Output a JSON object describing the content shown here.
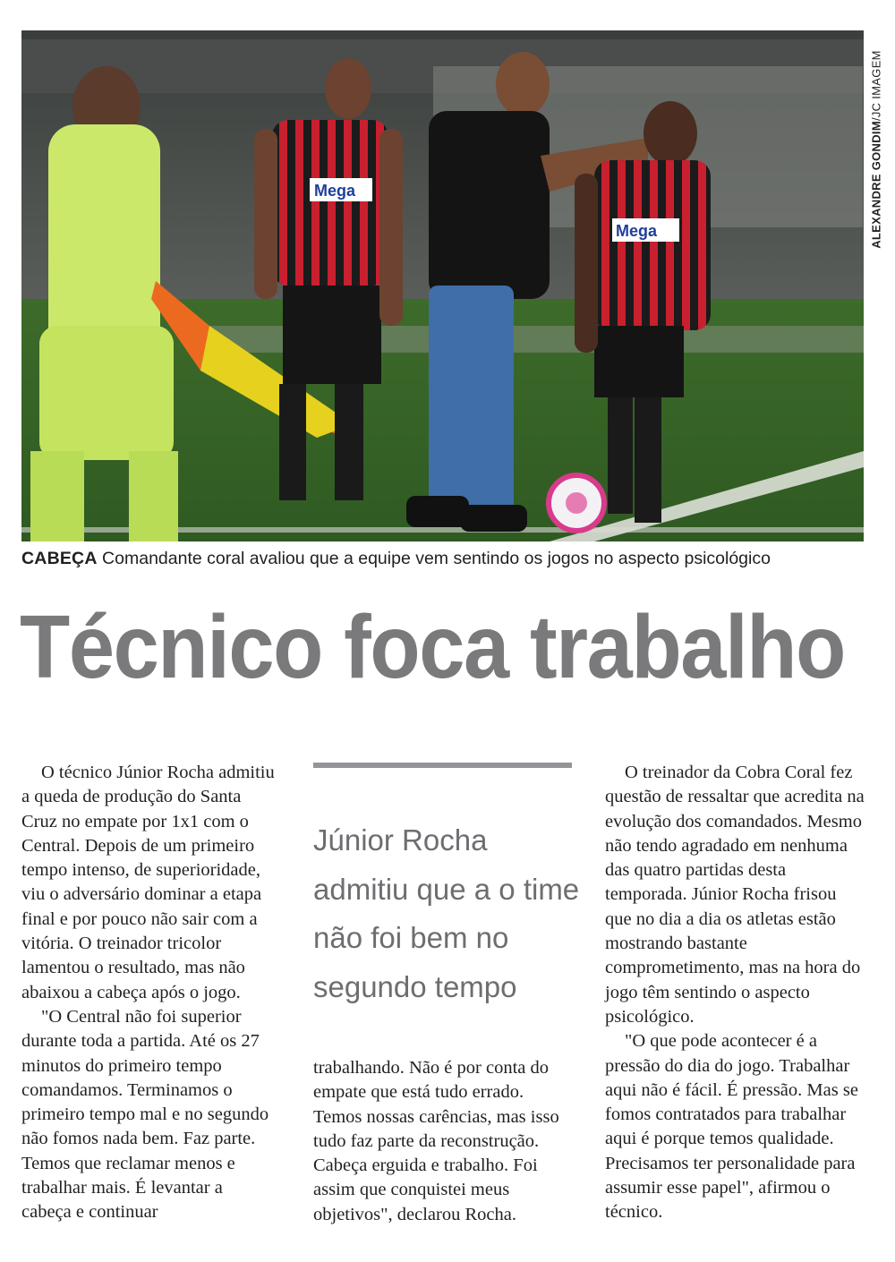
{
  "photo": {
    "credit_author": "ALEXANDRE GONDIM",
    "credit_agency": "JC IMAGEM",
    "jersey_text": "Mega"
  },
  "caption": {
    "kicker": "CABEÇA",
    "text": "Comandante coral avaliou que a equipe vem sentindo os jogos no aspecto psicológico"
  },
  "headline": "Técnico foca trabalho",
  "pullquote": "Júnior Rocha admitiu que a o time não foi bem no segundo tempo",
  "body": {
    "col1_p1": "O técnico Júnior Rocha admitiu a queda de produção do Santa Cruz no empate por 1x1 com o Central. Depois de um primeiro tempo intenso, de superioridade, viu o adversário dominar a etapa final e por pouco não sair com a vitória. O treinador tricolor lamentou o resultado, mas não abaixou a cabeça após o jogo.",
    "col1_p2": "\"O Central não foi superior durante toda a partida. Até os 27 minutos do primeiro tempo comandamos. Terminamos o primeiro tempo mal e no segundo não fomos nada bem. Faz parte. Temos que reclamar menos e trabalhar mais. É levantar a cabeça e continuar",
    "col2_p1": "trabalhando. Não é por conta do empate que está tudo errado. Temos nossas carências, mas isso tudo faz parte da reconstrução. Cabeça erguida e trabalho. Foi assim que conquistei meus objetivos\", declarou Rocha.",
    "col3_p1": "O treinador da Cobra Coral fez questão de ressaltar que acredita na evolução dos comandados. Mesmo não tendo agradado em nenhuma das quatro partidas desta temporada. Júnior Rocha frisou que no dia a dia os atletas estão mostrando bastante comprometimento, mas na hora do jogo têm sentindo o aspecto psicológico.",
    "col3_p2": "\"O que pode acontecer é a pressão do dia do jogo. Trabalhar aqui não é fácil. É pressão. Mas se fomos contratados para trabalhar aqui é porque temos qualidade. Precisamos ter personalidade para assumir esse papel\", afirmou o técnico."
  }
}
